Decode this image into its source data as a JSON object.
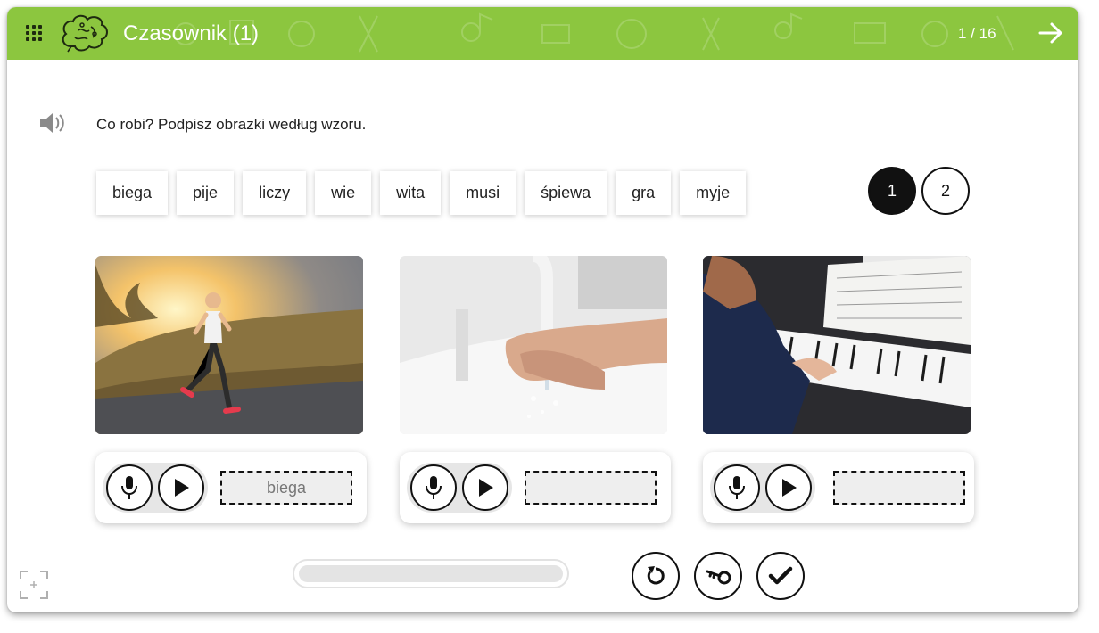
{
  "header": {
    "title": "Czasownik (1)",
    "counter": "1 / 16",
    "background_color": "#8cc63f",
    "icons": [
      "grid-menu-icon",
      "brain-logo-icon",
      "arrow-right-icon"
    ]
  },
  "exercise": {
    "instruction": "Co robi? Podpisz obrazki według wzoru.",
    "word_chips": [
      "biega",
      "pije",
      "liczy",
      "wie",
      "wita",
      "musi",
      "śpiewa",
      "gra",
      "myje"
    ],
    "pages": [
      "1",
      "2"
    ],
    "active_page": "1",
    "items": [
      {
        "photo": "woman-running-at-sunset",
        "answer": "biega"
      },
      {
        "photo": "hands-washing-under-tap",
        "answer": ""
      },
      {
        "photo": "person-playing-piano",
        "answer": ""
      }
    ]
  },
  "progress": {
    "fraction": 0.0
  },
  "icons": {
    "speaker": "speaker-icon",
    "microphone": "microphone-icon",
    "play": "play-icon",
    "reset": "reset-icon",
    "key": "key-icon",
    "check": "check-icon",
    "fullscreen": "fullscreen-icon"
  }
}
